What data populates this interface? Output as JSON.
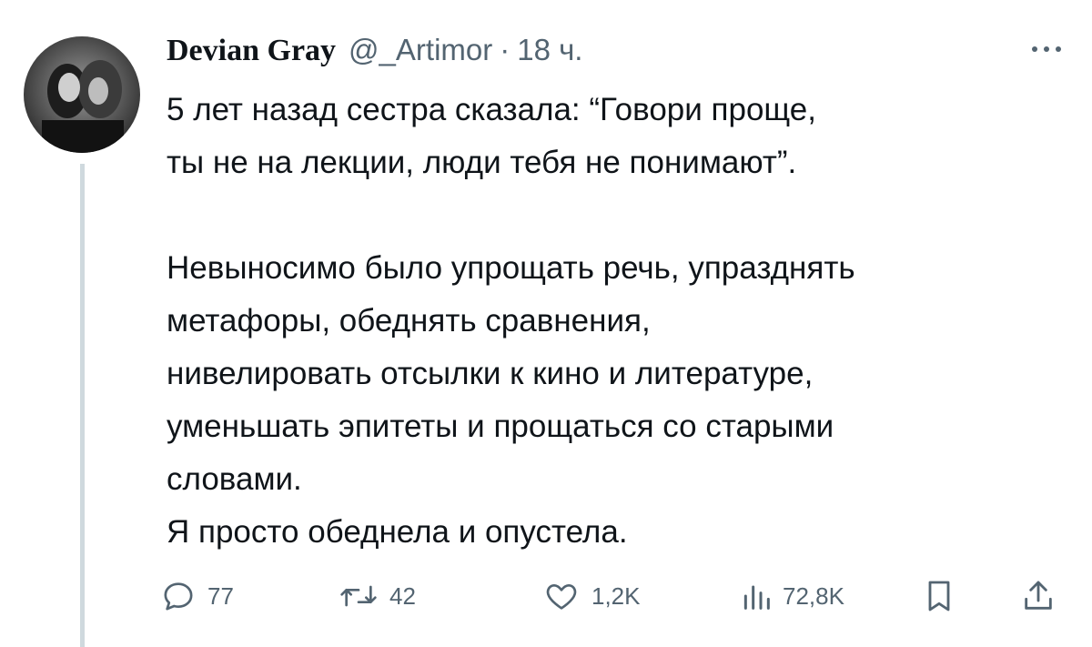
{
  "tweet": {
    "author_name": "Devian Gray",
    "handle": "@_Artimor",
    "separator": "·",
    "time": "18 ч.",
    "paragraph1": [
      "5 лет назад сестра сказала: “Говори проще,",
      "ты не на лекции, люди тебя не понимают”."
    ],
    "paragraph2": [
      "Невыносимо было упрощать речь, упразднять",
      "метафоры, обеднять сравнения,",
      "нивелировать отсылки к кино и литературе,",
      "уменьшать эпитеты и прощаться со старыми",
      "словами.",
      "Я просто обеднела и опустела."
    ]
  },
  "actions": {
    "replies": "77",
    "reposts": "42",
    "likes": "1,2K",
    "views": "72,8K"
  },
  "icons": {
    "reply": "speech-bubble-icon",
    "repost": "repost-arrows-icon",
    "like": "heart-icon",
    "views": "bar-chart-icon",
    "bookmark": "bookmark-icon",
    "share": "share-upload-icon",
    "more": "more-dots-icon"
  },
  "colors": {
    "text": "#0f1419",
    "secondary": "#536471",
    "thread_line": "#cfd9de"
  }
}
